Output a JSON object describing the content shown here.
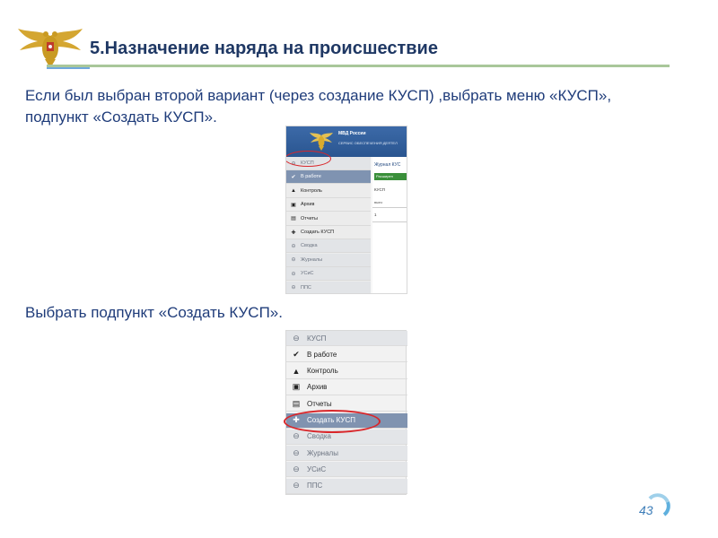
{
  "slide": {
    "title": "5.Назначение наряда на происшествие",
    "intro": "Если был выбран второй вариант (через создание КУСП) ,выбрать меню «КУСП», подпункт «Создать КУСП».",
    "caption2": "Выбрать подпункт «Создать КУСП».",
    "page_number": "43"
  },
  "screenshot1": {
    "brand": "МВД России",
    "subtitle": "СЕРВИС ОБЕСПЕЧЕНИЯ ДЕЯТЕЛ",
    "menu": [
      {
        "label": "КУСП",
        "icon": "collapse-icon",
        "kind": "group"
      },
      {
        "label": "В работе",
        "icon": "check-icon",
        "kind": "active"
      },
      {
        "label": "Контроль",
        "icon": "warning-icon",
        "kind": "item"
      },
      {
        "label": "Архив",
        "icon": "archive-icon",
        "kind": "item"
      },
      {
        "label": "Отчеты",
        "icon": "report-icon",
        "kind": "item"
      },
      {
        "label": "Создать КУСП",
        "icon": "plus-icon",
        "kind": "item"
      },
      {
        "label": "Сводка",
        "icon": "collapse-icon",
        "kind": "group"
      },
      {
        "label": "Журналы",
        "icon": "collapse-icon",
        "kind": "group"
      },
      {
        "label": "УСиС",
        "icon": "collapse-icon",
        "kind": "group"
      },
      {
        "label": "ППС",
        "icon": "collapse-icon",
        "kind": "group"
      }
    ],
    "panel": {
      "title": "Журнал КУС",
      "button": "Расширен",
      "section": "КУСП",
      "column": "выез",
      "row_value": "1"
    }
  },
  "screenshot2": {
    "menu": [
      {
        "label": "КУСП",
        "icon": "collapse-icon",
        "kind": "group"
      },
      {
        "label": "В работе",
        "icon": "check-icon",
        "kind": "item"
      },
      {
        "label": "Контроль",
        "icon": "warning-icon",
        "kind": "item"
      },
      {
        "label": "Архив",
        "icon": "archive-icon",
        "kind": "item"
      },
      {
        "label": "Отчеты",
        "icon": "report-icon",
        "kind": "item"
      },
      {
        "label": "Создать КУСП",
        "icon": "plus-icon",
        "kind": "active"
      },
      {
        "label": "Сводка",
        "icon": "collapse-icon",
        "kind": "group"
      },
      {
        "label": "Журналы",
        "icon": "collapse-icon",
        "kind": "group"
      },
      {
        "label": "УСиС",
        "icon": "collapse-icon",
        "kind": "group"
      },
      {
        "label": "ППС",
        "icon": "collapse-icon",
        "kind": "group"
      }
    ]
  },
  "colors": {
    "title": "#1f3864",
    "text": "#1f3c7a",
    "highlight_circle": "#d9262a",
    "active_item": "#8093b0",
    "rule": "#a9c79a"
  }
}
